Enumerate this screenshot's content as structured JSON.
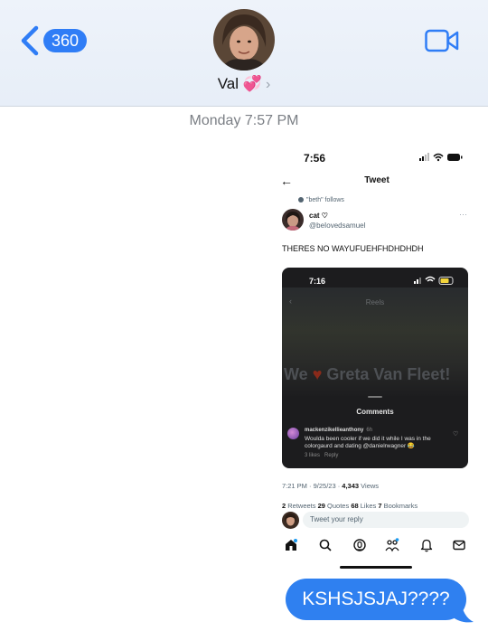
{
  "header": {
    "back_count": "360",
    "contact_name": "Val 💞",
    "chevron": "›",
    "icons": {
      "back": "chevron-left-icon",
      "video": "video-camera-icon"
    },
    "accent_color": "#2f7df6"
  },
  "timestamp": "Monday 7:57 PM",
  "attachment": {
    "status_time": "7:56",
    "title": "Tweet",
    "back_arrow": "←",
    "follows_note": "\"beth\" follows",
    "author_name": "cat ♡",
    "author_handle": "@beIovedsamuel",
    "more": "···",
    "tweet_text": "THERES NO WAYUFUEHFHDHDHDH",
    "media": {
      "status_time": "7:16",
      "reels_label": "Reels",
      "back": "‹",
      "big_text_pre": "We ",
      "big_text_heart": "♥",
      "big_text_post": " Greta Van Fleet!",
      "comments_title": "Comments",
      "comment_user": "mackenzikellieanthony",
      "comment_age": "6h",
      "comment_text": "Woulda been cooler if we did it while I was in the colorgaurd and dating @danielrwagner 😂",
      "comment_likes": "3 likes",
      "comment_reply": "Reply",
      "heart": "♡"
    },
    "time_pre": "7:21 PM · 9/25/23 · ",
    "views_count": "4,343",
    "views_label": " Views",
    "stats": {
      "retweets": "2",
      "retweets_label": " Retweets  ",
      "quotes": "29",
      "quotes_label": " Quotes  ",
      "likes": "68",
      "likes_label": " Likes  ",
      "bookmarks": "7",
      "bookmarks_label": " Bookmarks"
    },
    "reply_placeholder": "Tweet your reply",
    "nav_icons": [
      "home-icon",
      "search-icon",
      "spaces-icon",
      "communities-icon",
      "notifications-icon",
      "messages-icon"
    ]
  },
  "message": {
    "text": "KSHSJSJAJ????",
    "bubble_color": "#2f80f0"
  }
}
